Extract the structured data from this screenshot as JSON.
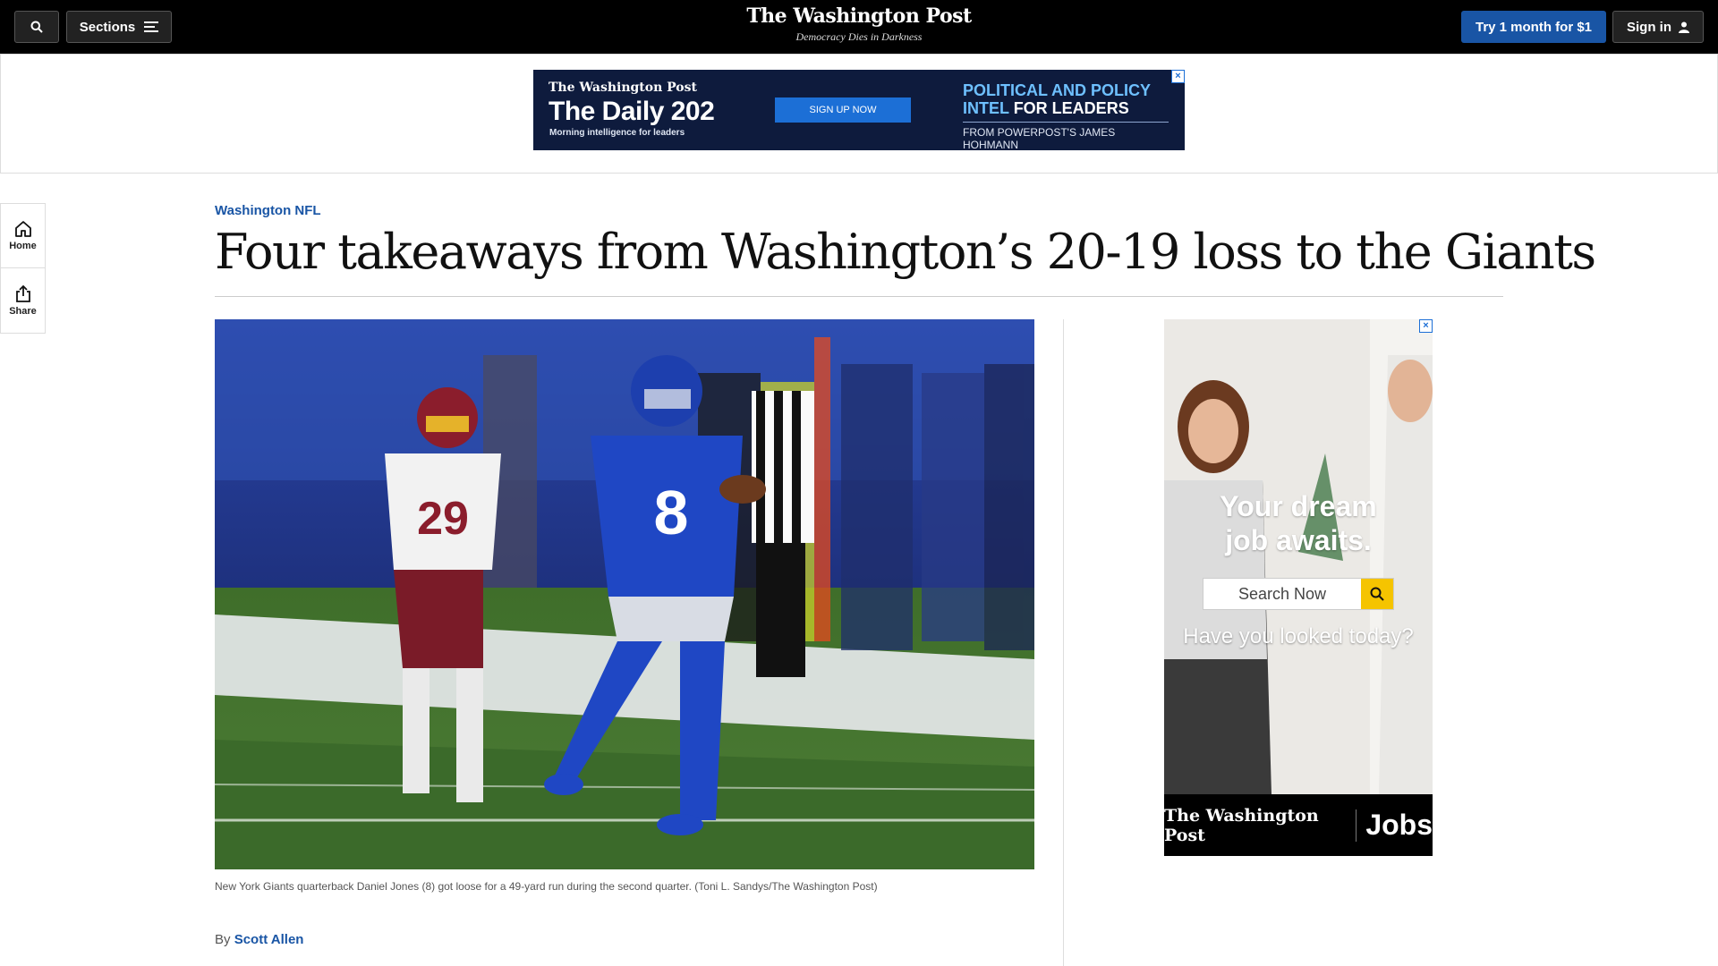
{
  "header": {
    "search_label": "",
    "sections_label": "Sections",
    "logo_text": "The Washington Post",
    "tagline": "Democracy Dies in Darkness",
    "subscribe_label": "Try 1 month for $1",
    "signin_label": "Sign in",
    "background_color": "#000000",
    "accent_color": "#1955a5"
  },
  "top_ad": {
    "logo": "The Washington Post",
    "title": "The Daily 202",
    "subtitle": "Morning intelligence for leaders",
    "cta": "SIGN UP NOW",
    "line1": "POLITICAL AND POLICY",
    "line2_highlight": "INTEL",
    "line2_rest": "FOR LEADERS",
    "from": "FROM POWERPOST'S JAMES HOHMANN",
    "close": "×"
  },
  "rail": {
    "items": [
      {
        "label": "Home",
        "icon": "home-icon"
      },
      {
        "label": "Share",
        "icon": "share-icon"
      }
    ]
  },
  "article": {
    "kicker": "Washington NFL",
    "headline": "Four takeaways from Washington’s 20-19 loss to the Giants",
    "caption": "New York Giants quarterback Daniel Jones (8) got loose for a 49-yard run during the second quarter. (Toni L. Sandys/The Washington Post)",
    "byline_prefix": "By",
    "author": "Scott Allen",
    "photo": {
      "jersey_giants": "8",
      "jersey_washington": "29"
    }
  },
  "side_ad": {
    "headline_line1": "Your dream",
    "headline_line2": "job awaits.",
    "search_placeholder": "Search Now",
    "tagline": "Have you looked today?",
    "footer_logo": "The Washington Post",
    "footer_jobs": "Jobs",
    "close": "×"
  }
}
